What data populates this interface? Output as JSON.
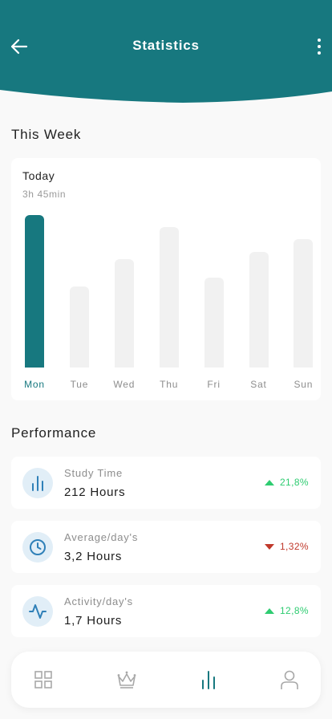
{
  "header": {
    "title": "Statistics",
    "back_icon": "arrow-left-icon",
    "more_icon": "more-vertical-icon",
    "color": "#17787f"
  },
  "week": {
    "section_title": "This Week",
    "today_label": "Today",
    "today_time": "3h 45min",
    "accent_color": "#17787f"
  },
  "chart_data": {
    "type": "bar",
    "categories": [
      "Mon",
      "Tue",
      "Wed",
      "Thu",
      "Fri",
      "Sat",
      "Sun"
    ],
    "values": [
      1.0,
      0.53,
      0.71,
      0.92,
      0.59,
      0.76,
      0.84
    ],
    "active_index": 0,
    "title": "",
    "xlabel": "",
    "ylabel": "",
    "ylim": [
      0,
      1
    ],
    "grid": false
  },
  "performance": {
    "section_title": "Performance",
    "items": [
      {
        "icon": "bar-chart-icon",
        "label": "Study Time",
        "value": "212 Hours",
        "change": "21,8%",
        "trend": "up",
        "color": "#2ecc71"
      },
      {
        "icon": "clock-icon",
        "label": "Average/day's",
        "value": "3,2 Hours",
        "change": "1,32%",
        "trend": "down",
        "color": "#c0392b"
      },
      {
        "icon": "activity-icon",
        "label": "Activity/day's",
        "value": "1,7 Hours",
        "change": "12,8%",
        "trend": "up",
        "color": "#2ecc71"
      }
    ]
  },
  "bottom_nav": {
    "items": [
      {
        "icon": "grid-icon",
        "active": false
      },
      {
        "icon": "crown-icon",
        "active": false
      },
      {
        "icon": "bar-chart-icon",
        "active": true
      },
      {
        "icon": "user-icon",
        "active": false
      }
    ]
  }
}
